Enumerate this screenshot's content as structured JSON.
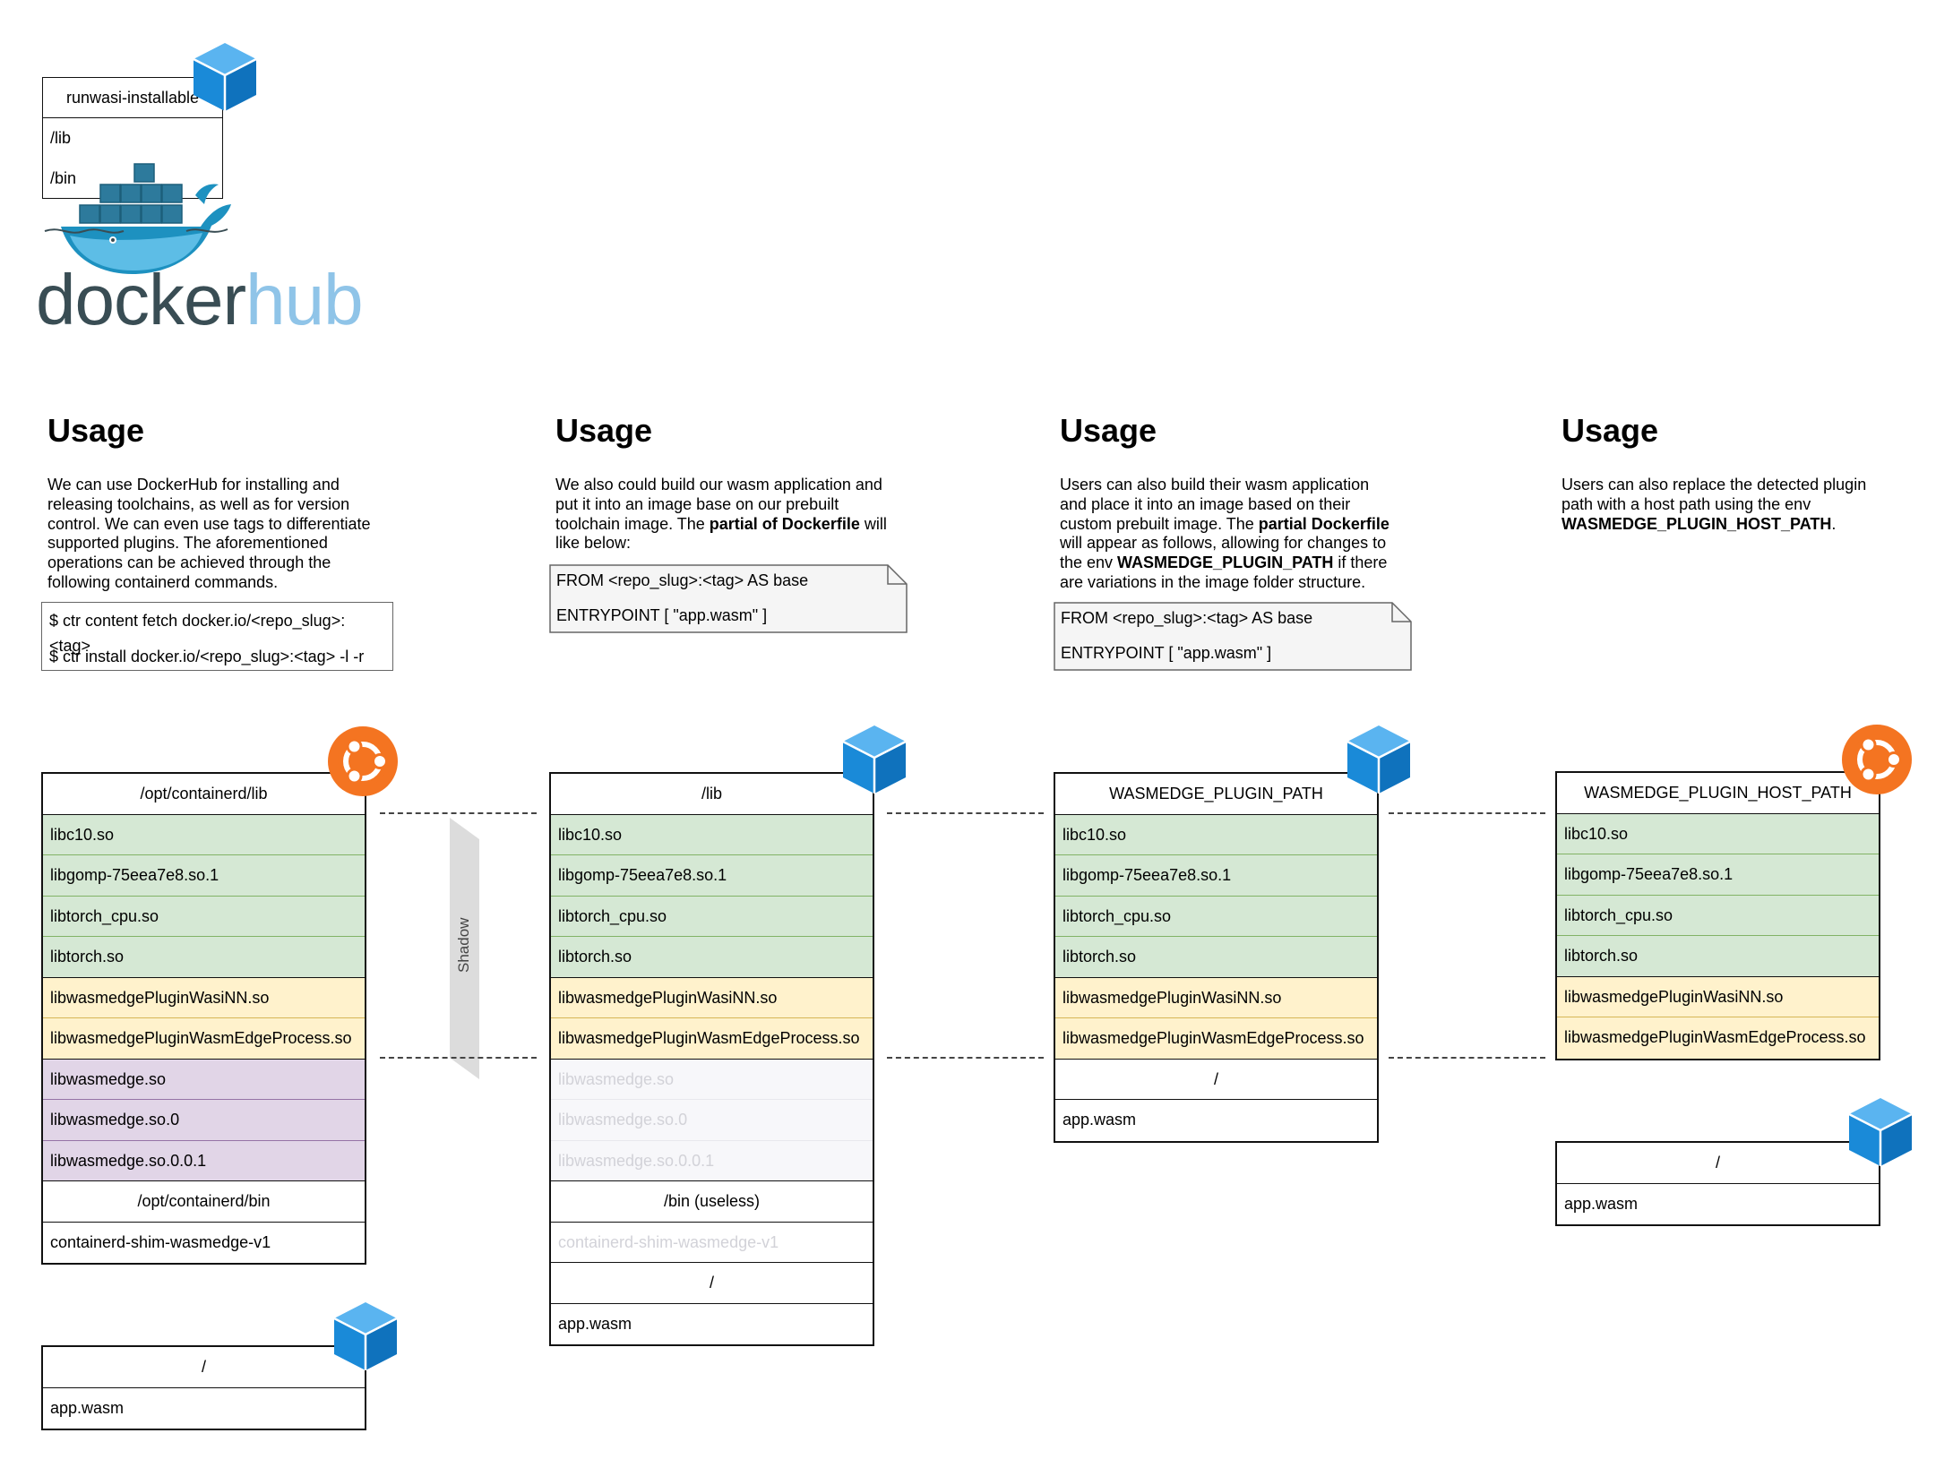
{
  "colors": {
    "green": "#d5e8d4",
    "yellow": "#fff2cc",
    "purple": "#e1d5e7",
    "ubuntu": "#f47421",
    "cube": "#1e90e6",
    "docker_dark": "#394d54",
    "docker_light": "#8fc4e8"
  },
  "dockerhub": {
    "logo_word_dark": "docker",
    "logo_word_light": "hub",
    "box_title": "runwasi-installable",
    "box_rows": [
      "/lib",
      "/bin"
    ]
  },
  "usage1": {
    "heading": "Usage",
    "paragraph": [
      "We can use DockerHub for installing and",
      "releasing toolchains, as well as for version",
      "control. We can even use tags to differentiate",
      "supported plugins. The aforementioned",
      "operations can be achieved through the",
      "following containerd commands."
    ],
    "commands": [
      "$ ctr content fetch docker.io/<repo_slug>:<tag>",
      "$ ctr install docker.io/<repo_slug>:<tag> -l -r"
    ]
  },
  "usage2": {
    "heading": "Usage",
    "p1": "We also could build our wasm application and",
    "p2": "put it into an image base on our prebuilt",
    "p3a": "toolchain image. The ",
    "p3b": "partial of Dockerfile",
    "p3c": " will",
    "p4": "like below:",
    "dockerfile": [
      "FROM <repo_slug>:<tag> AS base",
      "ENTRYPOINT [ \"app.wasm\" ]"
    ]
  },
  "usage3": {
    "heading": "Usage",
    "p1": "Users can also build their wasm application",
    "p2": "and place it into an image based on their",
    "p3a": "custom prebuilt image. The ",
    "p3b": "partial Dockerfile",
    "p4": "will appear as follows, allowing for changes to",
    "p5a": "the env ",
    "p5b": "WASMEDGE_PLUGIN_PATH",
    "p5c": " if there",
    "p6": "are variations in the image folder structure.",
    "dockerfile": [
      "FROM <repo_slug>:<tag> AS base",
      "ENTRYPOINT [ \"app.wasm\" ]"
    ]
  },
  "usage4": {
    "heading": "Usage",
    "p1": "Users can also replace the detected plugin",
    "p2": "path with a host path using the env",
    "p3b": "WASMEDGE_PLUGIN_HOST_PATH",
    "p3c": "."
  },
  "col1": {
    "header": "/opt/containerd/lib",
    "green": [
      "libc10.so",
      "libgomp-75eea7e8.so.1",
      "libtorch_cpu.so",
      "libtorch.so"
    ],
    "yellow": [
      "libwasmedgePluginWasiNN.so",
      "libwasmedgePluginWasmEdgeProcess.so"
    ],
    "purple": [
      "libwasmedge.so",
      "libwasmedge.so.0",
      "libwasmedge.so.0.0.1"
    ],
    "bin_header": "/opt/containerd/bin",
    "bin_rows": [
      "containerd-shim-wasmedge-v1"
    ],
    "app_header": "/",
    "app_rows": [
      "app.wasm"
    ]
  },
  "shadow_label": "Shadow",
  "col2": {
    "header": "/lib",
    "green": [
      "libc10.so",
      "libgomp-75eea7e8.so.1",
      "libtorch_cpu.so",
      "libtorch.so"
    ],
    "yellow": [
      "libwasmedgePluginWasiNN.so",
      "libwasmedgePluginWasmEdgeProcess.so"
    ],
    "ghost": [
      "libwasmedge.so",
      "libwasmedge.so.0",
      "libwasmedge.so.0.0.1"
    ],
    "bin_header": "/bin (useless)",
    "bin_rows": [
      "containerd-shim-wasmedge-v1"
    ],
    "root_header": "/",
    "app_rows": [
      "app.wasm"
    ]
  },
  "col3": {
    "header": "WASMEDGE_PLUGIN_PATH",
    "green": [
      "libc10.so",
      "libgomp-75eea7e8.so.1",
      "libtorch_cpu.so",
      "libtorch.so"
    ],
    "yellow": [
      "libwasmedgePluginWasiNN.so",
      "libwasmedgePluginWasmEdgeProcess.so"
    ],
    "root_header": "/",
    "app_rows": [
      "app.wasm"
    ]
  },
  "col4": {
    "header": "WASMEDGE_PLUGIN_HOST_PATH",
    "green": [
      "libc10.so",
      "libgomp-75eea7e8.so.1",
      "libtorch_cpu.so",
      "libtorch.so"
    ],
    "yellow": [
      "libwasmedgePluginWasiNN.so",
      "libwasmedgePluginWasmEdgeProcess.so"
    ],
    "app_header": "/",
    "app_rows": [
      "app.wasm"
    ]
  }
}
